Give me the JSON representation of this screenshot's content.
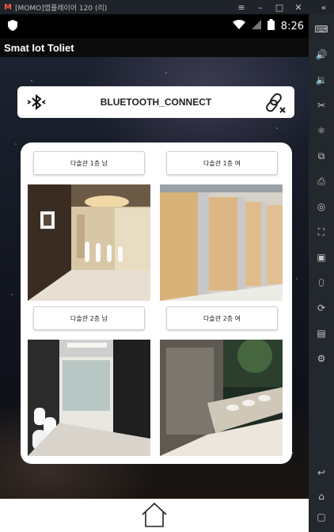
{
  "emulator": {
    "logo": "M",
    "title": "[MOMO]앱플레이어 120 (리)",
    "collapse_glyph": "«"
  },
  "status_bar": {
    "time": "8:26"
  },
  "app": {
    "title": "Smat Iot Toliet",
    "bluetooth_label": "BLUETOOTH_CONNECT",
    "restrooms": [
      {
        "label": "다솔관 1층 남",
        "photo": "modern men's restroom with urinals"
      },
      {
        "label": "다솔관 1층 여",
        "photo": "wood toilet cubicle partitions"
      },
      {
        "label": "다솔관 2층 남",
        "photo": "restroom with urinals and dark partitions"
      },
      {
        "label": "다솔관 2층 여",
        "photo": "restroom with sinks and mirror"
      }
    ]
  },
  "colors": {
    "card_bg": "#ffffff",
    "appbar_bg": "#0b0b0b",
    "statusbar_bg": "#000000",
    "emulator_chrome": "#23272e"
  }
}
